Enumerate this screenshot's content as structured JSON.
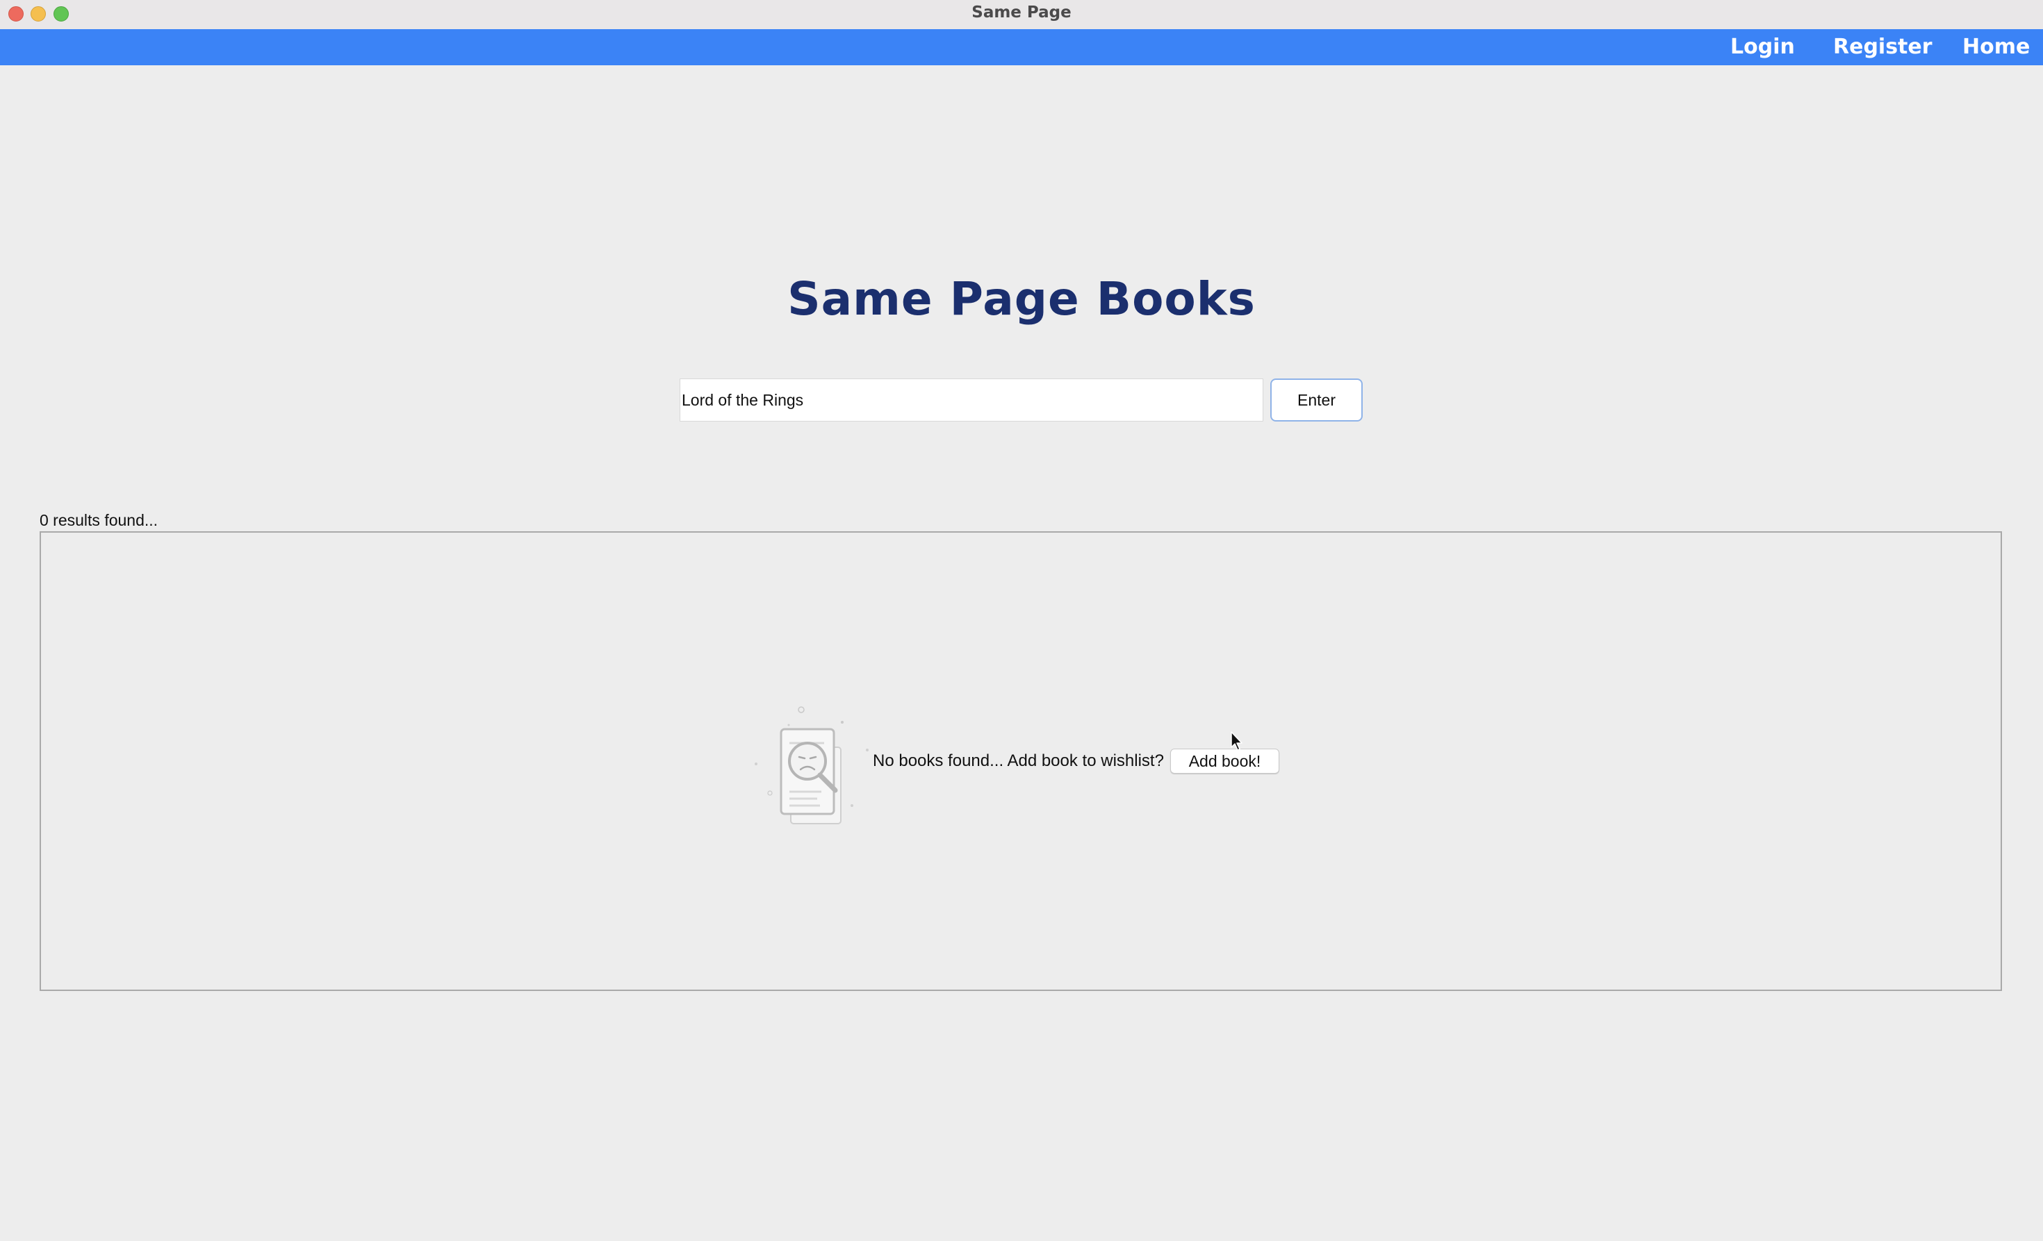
{
  "window": {
    "title": "Same Page"
  },
  "nav": {
    "login": "Login",
    "register": "Register",
    "home": "Home"
  },
  "hero": {
    "title": "Same Page Books"
  },
  "search": {
    "value": "Lord of the Rings",
    "enter_label": "Enter"
  },
  "results": {
    "count_text": "0 results found...",
    "empty_message": "No books found... Add book to wishlist?",
    "add_button_label": "Add book!"
  },
  "colors": {
    "navbar": "#3b83f6",
    "title": "#1b2f6e",
    "background": "#ededed"
  },
  "icons": {
    "empty_state": "no-results-search-document-icon",
    "cursor": "mouse-pointer-icon"
  }
}
